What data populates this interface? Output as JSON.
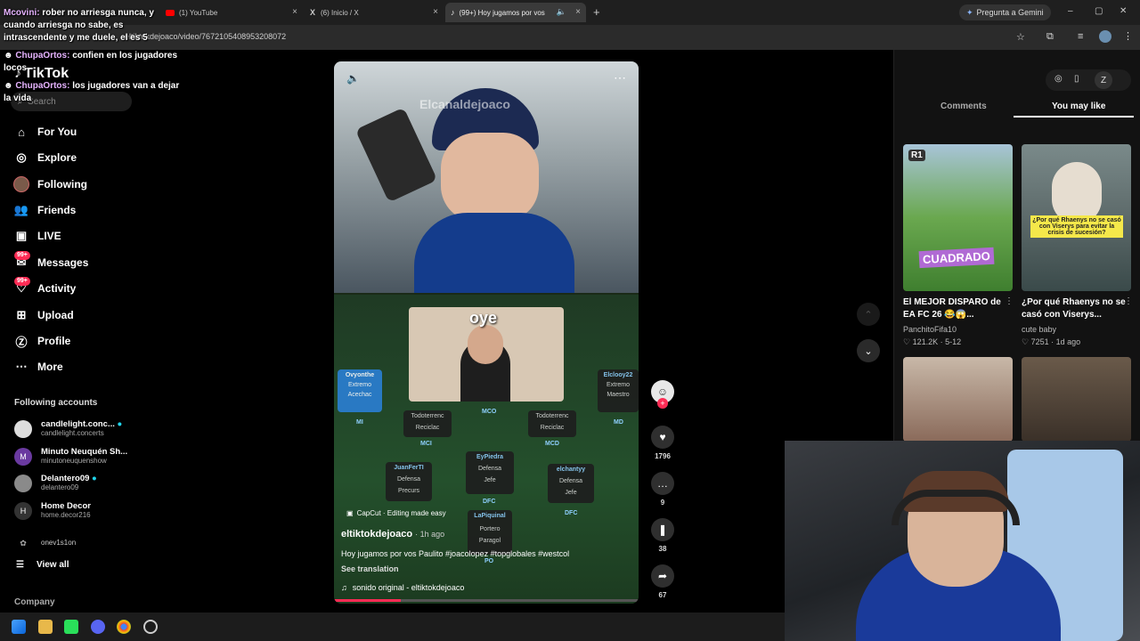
{
  "browser": {
    "tabs": [
      {
        "title": "(1) YouTube",
        "close": "×"
      },
      {
        "title": "(6) Inicio / X",
        "close": "×"
      },
      {
        "title": "(99+) Hoy jugamos por vos",
        "close": "×"
      }
    ],
    "new_tab": "+",
    "gemini_label": "Pregunta a Gemini",
    "url": "eltiktokdejoaco/video/7672105408953208072",
    "window_controls": {
      "minimize": "–",
      "maximize": "▢",
      "close": "✕"
    }
  },
  "chat": [
    {
      "user": "Mcovini:",
      "text": "rober no arriesga nunca, y cuando arriesga no sabe, es intrascendente y me duele, el es 5"
    },
    {
      "user": "ChupaOrtos:",
      "text": "confien en los jugadores locos"
    },
    {
      "user": "ChupaOrtos:",
      "text": "los jugadores van a dejar la vida"
    }
  ],
  "sidebar": {
    "logo": "TikTok",
    "search_placeholder": "Search",
    "nav": [
      {
        "label": "For You",
        "icon": "home-icon"
      },
      {
        "label": "Explore",
        "icon": "compass-icon"
      },
      {
        "label": "Following",
        "icon": "following-avatar-icon"
      },
      {
        "label": "Friends",
        "icon": "friends-icon"
      },
      {
        "label": "LIVE",
        "icon": "live-icon"
      },
      {
        "label": "Messages",
        "icon": "messages-icon",
        "badge": "99+"
      },
      {
        "label": "Activity",
        "icon": "activity-icon",
        "badge": "99+"
      },
      {
        "label": "Upload",
        "icon": "upload-icon"
      },
      {
        "label": "Profile",
        "icon": "profile-icon"
      },
      {
        "label": "More",
        "icon": "more-icon"
      }
    ],
    "following_header": "Following accounts",
    "accounts": [
      {
        "name": "candlelight.conc...",
        "handle": "candlelight.concerts",
        "verified": true
      },
      {
        "name": "Minuto Neuquén Sh...",
        "handle": "minutoneuquenshow",
        "verified": false
      },
      {
        "name": "Delantero09",
        "handle": "delantero09",
        "verified": true
      },
      {
        "name": "Home Decor",
        "handle": "home.decor216",
        "verified": false
      },
      {
        "name": "",
        "handle": "onev1s1on",
        "verified": false
      }
    ],
    "view_all": "View all",
    "company": "Company"
  },
  "video": {
    "watermark": "Elcanaldejoaco",
    "caption_overlay": "oye",
    "players": [
      {
        "name": "Ovyonthe",
        "role": "Extremo",
        "trait": "Acechac",
        "pos": "MI"
      },
      {
        "name": "Elclooy22",
        "role": "Extremo",
        "trait": "Maestro",
        "pos": "MD"
      },
      {
        "name": "",
        "role": "Todoterrenc",
        "trait": "Reciclac",
        "pos": "MCI"
      },
      {
        "name": "",
        "role": "Todoterrenc",
        "trait": "Reciclac",
        "pos": "MCD"
      },
      {
        "name": "JuanFerTI",
        "role": "Defensa",
        "trait": "Precurs",
        "pos": ""
      },
      {
        "name": "EyPiedra",
        "role": "Defensa",
        "trait": "Jefe",
        "pos": "DFC"
      },
      {
        "name": "elchantyy",
        "role": "Defensa",
        "trait": "Jefe",
        "pos": "DFC"
      },
      {
        "name": "LaPiquinal",
        "role": "Portero",
        "trait": "Paragol",
        "pos": "PO"
      }
    ],
    "mco_label": "MCO",
    "capcut": "CapCut · Editing made easy",
    "author": "eltiktokdejoaco",
    "time_ago": "· 1h ago",
    "description": "Hoy jugamos por vos Paulito #joacolopez #topglobales #westcol",
    "see_translation": "See translation",
    "sound": "sonido original - eltiktokdejoaco"
  },
  "actions": {
    "likes": "1796",
    "comments": "9",
    "saves": "38",
    "shares": "67"
  },
  "right_panel": {
    "tabs": [
      "Comments",
      "You may like"
    ],
    "active_tab": "You may like",
    "videos": [
      {
        "title": "El MEJOR DISPARO de EA FC 26 😂😱...",
        "author": "PanchitoFifa10",
        "likes": "121.2K",
        "date": "5-12",
        "thumb_text": "CUADRADO",
        "thumb_tag": "R1"
      },
      {
        "title": "¿Por qué Rhaenys no se casó con Viserys...",
        "author": "cute baby",
        "likes": "7251",
        "date": "1d ago",
        "thumb_text": "¿Por qué Rhaenys no se casó con Viserys para evitar la crisis de sucesión?"
      }
    ]
  },
  "colors": {
    "accent": "#fe2c55",
    "teal": "#20d5ec",
    "background": "#000000"
  }
}
